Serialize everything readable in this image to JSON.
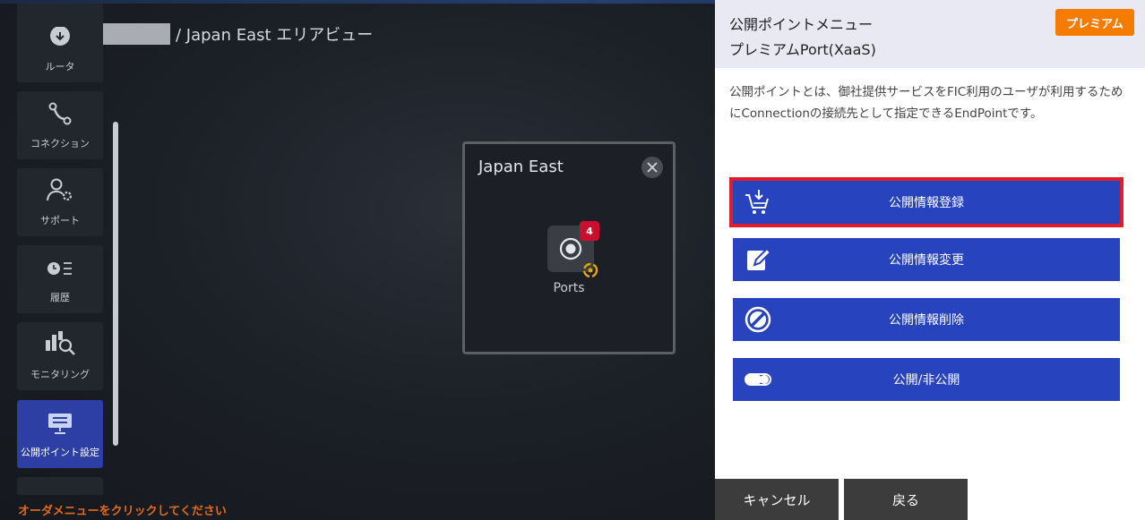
{
  "breadcrumb": {
    "current": "/ Japan East エリアビュー"
  },
  "nav": {
    "items": [
      {
        "label": "ルータ",
        "icon": "router-icon"
      },
      {
        "label": "コネクション",
        "icon": "connection-icon"
      },
      {
        "label": "サポート",
        "icon": "support-icon"
      },
      {
        "label": "履歴",
        "icon": "history-icon"
      },
      {
        "label": "モニタリング",
        "icon": "monitoring-icon"
      },
      {
        "label": "公開ポイント設定",
        "icon": "monitor-icon",
        "active": true
      }
    ]
  },
  "hint": "オーダメニューをクリックしてください",
  "area": {
    "title": "Japan East",
    "port_label": "Ports",
    "port_count": "4"
  },
  "panel": {
    "title": "公開ポイントメニュー",
    "subtitle": "プレミアムPort(XaaS)",
    "badge": "プレミアム",
    "description": "公開ポイントとは、御社提供サービスをFIC利用のユーザが利用するためにConnectionの接続先として指定できるEndPointです。",
    "actions": [
      {
        "label": "公開情報登録",
        "icon": "cart-add-icon",
        "selected": true
      },
      {
        "label": "公開情報変更",
        "icon": "edit-icon"
      },
      {
        "label": "公開情報削除",
        "icon": "prohibit-icon"
      },
      {
        "label": "公開/非公開",
        "icon": "toggle-icon"
      }
    ],
    "cancel_label": "キャンセル",
    "back_label": "戻る"
  },
  "colors": {
    "accent": "#2743bd",
    "premium": "#f57c00",
    "highlight": "#e21c2a",
    "hint": "#e06a1e"
  }
}
